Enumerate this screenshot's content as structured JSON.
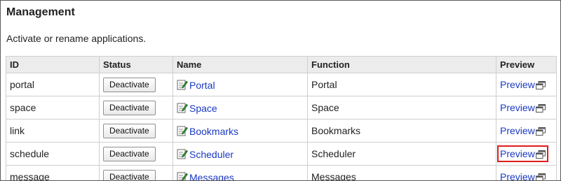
{
  "page": {
    "title": "Management",
    "description": "Activate or rename applications."
  },
  "table": {
    "headers": {
      "id": "ID",
      "status": "Status",
      "name": "Name",
      "function": "Function",
      "preview": "Preview"
    },
    "rows": [
      {
        "id": "portal",
        "status_button": "Deactivate",
        "name": "Portal",
        "function": "Portal",
        "preview": "Preview",
        "highlighted": false
      },
      {
        "id": "space",
        "status_button": "Deactivate",
        "name": "Space",
        "function": "Space",
        "preview": "Preview",
        "highlighted": false
      },
      {
        "id": "link",
        "status_button": "Deactivate",
        "name": "Bookmarks",
        "function": "Bookmarks",
        "preview": "Preview",
        "highlighted": false
      },
      {
        "id": "schedule",
        "status_button": "Deactivate",
        "name": "Scheduler",
        "function": "Scheduler",
        "preview": "Preview",
        "highlighted": true
      },
      {
        "id": "message",
        "status_button": "Deactivate",
        "name": "Messages",
        "function": "Messages",
        "preview": "Preview",
        "highlighted": false
      }
    ]
  },
  "colors": {
    "link": "#1a39c4",
    "header_bg": "#ececec",
    "highlight": "#e01c1c"
  },
  "icons": {
    "name_icon": "edit-icon",
    "preview_icon": "open-window-icon"
  }
}
